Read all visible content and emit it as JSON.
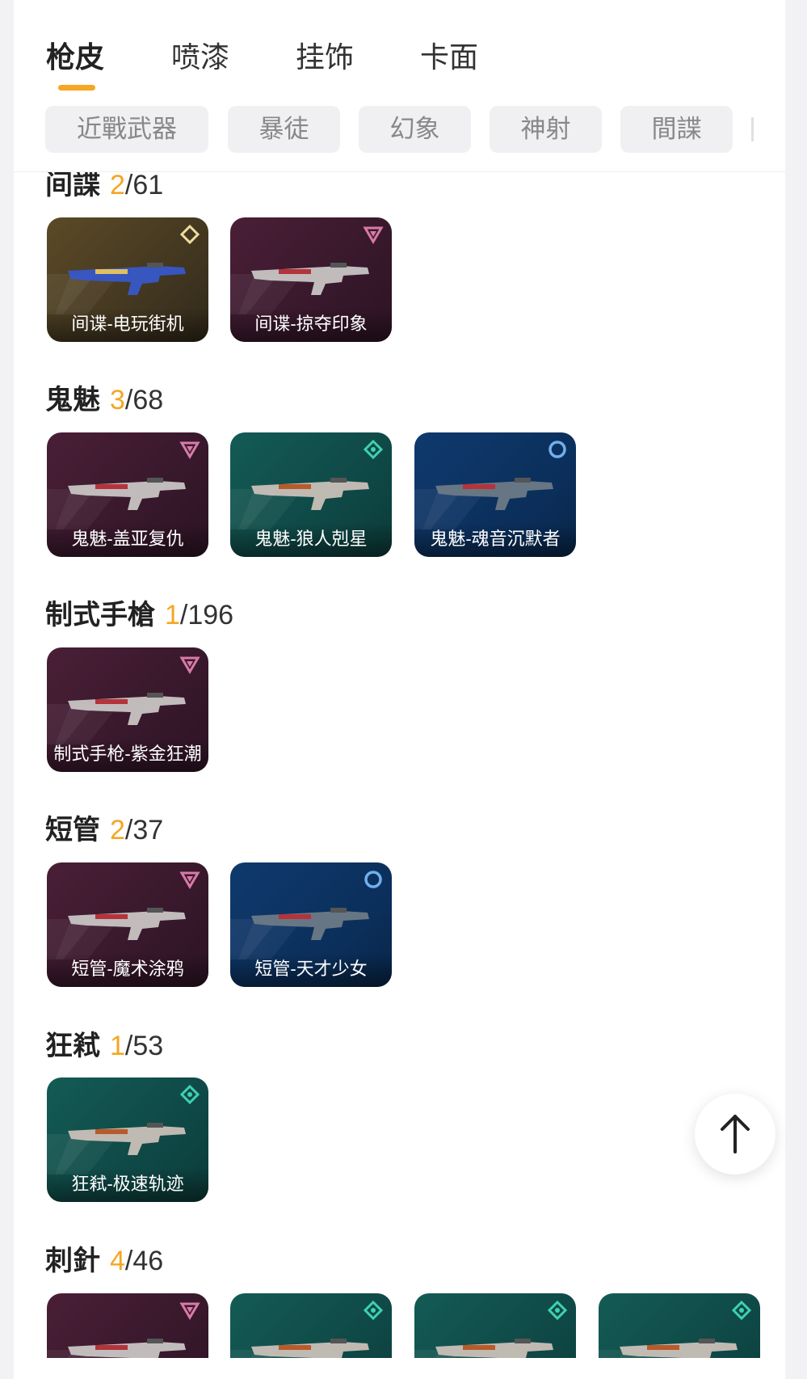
{
  "tabs": [
    {
      "label": "枪皮",
      "active": true
    },
    {
      "label": "喷漆",
      "active": false
    },
    {
      "label": "挂饰",
      "active": false
    },
    {
      "label": "卡面",
      "active": false
    }
  ],
  "filter_chips": [
    "近戰武器",
    "暴徒",
    "幻象",
    "神射",
    "間諜"
  ],
  "sections": [
    {
      "name": "间諜",
      "owned": "2",
      "total": "/61",
      "items": [
        {
          "label": "间谍-电玩街机",
          "tier": "gold-diamond-icon",
          "bg": "gold"
        },
        {
          "label": "间谍-掠夺印象",
          "tier": "pink-triangle-icon",
          "bg": "purple"
        }
      ]
    },
    {
      "name": "鬼魅",
      "owned": "3",
      "total": "/68",
      "items": [
        {
          "label": "鬼魅-盖亚复仇",
          "tier": "pink-triangle-icon",
          "bg": "purple"
        },
        {
          "label": "鬼魅-狼人剋星",
          "tier": "green-diamond-icon",
          "bg": "green"
        },
        {
          "label": "鬼魅-魂音沉默者",
          "tier": "blue-circle-icon",
          "bg": "blue"
        }
      ]
    },
    {
      "name": "制式手槍",
      "owned": "1",
      "total": "/196",
      "items": [
        {
          "label": "制式手枪-紫金狂潮",
          "tier": "pink-triangle-icon",
          "bg": "purple"
        }
      ]
    },
    {
      "name": "短管",
      "owned": "2",
      "total": "/37",
      "items": [
        {
          "label": "短管-魔术涂鸦",
          "tier": "pink-triangle-icon",
          "bg": "purple"
        },
        {
          "label": "短管-天才少女",
          "tier": "blue-circle-icon",
          "bg": "blue"
        }
      ]
    },
    {
      "name": "狂弒",
      "owned": "1",
      "total": "/53",
      "items": [
        {
          "label": "狂弒-极速轨迹",
          "tier": "green-diamond-icon",
          "bg": "green"
        }
      ]
    },
    {
      "name": "刺針",
      "owned": "4",
      "total": "/46",
      "items": [
        {
          "label": "",
          "tier": "pink-triangle-icon",
          "bg": "purple"
        },
        {
          "label": "",
          "tier": "green-diamond-icon",
          "bg": "green"
        },
        {
          "label": "",
          "tier": "green-diamond-icon",
          "bg": "green"
        },
        {
          "label": "",
          "tier": "green-diamond-icon",
          "bg": "green"
        }
      ]
    }
  ],
  "scroll_top_icon": "arrow-up-icon",
  "colors": {
    "accent": "#f5a623",
    "purple": "#3d1a30",
    "green": "#0f4a47",
    "blue": "#0c3060",
    "gold": "#4a3c22"
  }
}
